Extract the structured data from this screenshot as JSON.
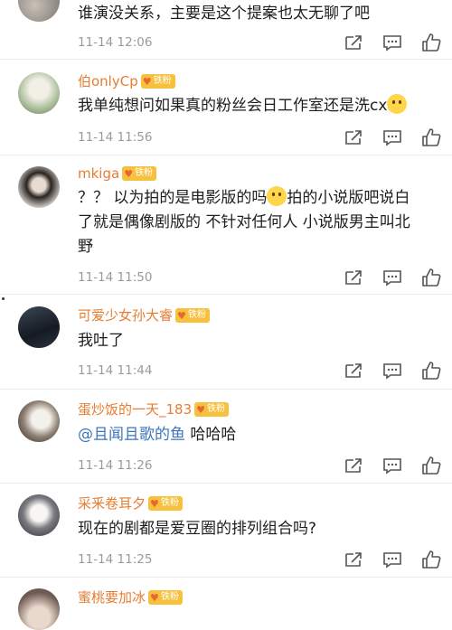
{
  "badge_label": "铁粉",
  "comments": [
    {
      "username": "",
      "text": "谁演没关系，主要是这个提案也太无聊了吧",
      "time": "11-14 12:06"
    },
    {
      "username": "伯onlyCp",
      "text": "我单纯想问如果真的粉丝会日工作室还是洗cx",
      "time": "11-14 11:56"
    },
    {
      "username": "mkiga",
      "text_a": "？？ 以为拍的是电影版的吗",
      "text_b": "拍的小说版吧说白了就是偶像剧版的 不针对任何人  小说版男主叫北野",
      "time": "11-14 11:50"
    },
    {
      "username": "可爱少女孙大睿",
      "text": "我吐了",
      "time": "11-14 11:44"
    },
    {
      "username": "蛋炒饭的一天_183",
      "mention": "@且闻且歌的鱼",
      "text": " 哈哈哈",
      "time": "11-14 11:26"
    },
    {
      "username": "采釆卷耳夕",
      "text": "现在的剧都是爱豆圈的排列组合吗?",
      "time": "11-14 11:25"
    },
    {
      "username": "蜜桃要加冰",
      "text": "",
      "time": ""
    }
  ],
  "icons": {
    "share": "share-icon",
    "comment": "comment-icon",
    "like": "like-icon",
    "badge": "heart-icon",
    "emoji": "emoji-icon"
  },
  "colors": {
    "username": "#e77d32",
    "badge": "#f7c13d",
    "mention": "#3e74bd",
    "time": "#9a9a9a"
  }
}
